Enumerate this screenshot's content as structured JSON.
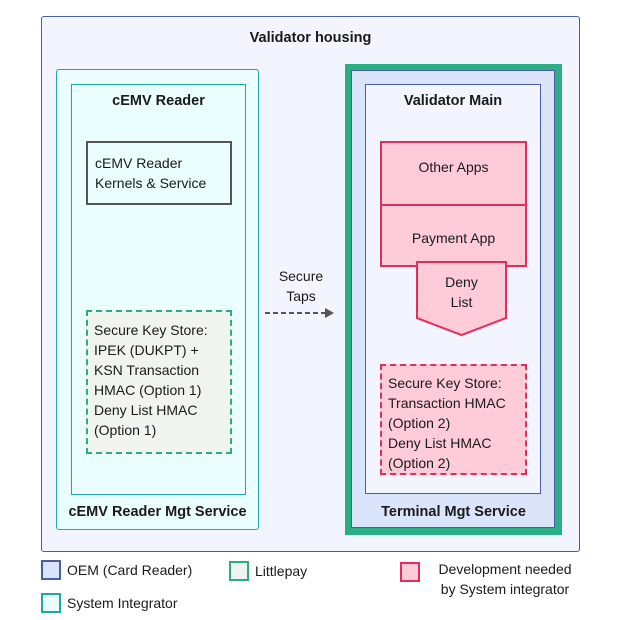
{
  "housing": {
    "title": "Validator housing"
  },
  "cemv_mgt": {
    "title": "cEMV Reader Mgt Service",
    "reader": {
      "title": "cEMV Reader",
      "kernels_lines": [
        "cEMV Reader",
        "Kernels & Service"
      ],
      "keystore_lines": [
        "Secure Key Store:",
        "IPEK (DUKPT) +",
        "KSN Transaction",
        "HMAC (Option 1)",
        "Deny List HMAC",
        "(Option 1)"
      ]
    }
  },
  "connector": {
    "label_lines": [
      "Secure",
      "Taps"
    ],
    "style": "dashed-arrow"
  },
  "terminal_mgt": {
    "title": "Terminal Mgt Service",
    "validator_main": {
      "title": "Validator Main",
      "other_apps": "Other Apps",
      "payment_app": "Payment App",
      "deny_list_lines": [
        "Deny",
        "List"
      ],
      "keystore_lines": [
        "Secure Key Store:",
        "Transaction HMAC",
        "(Option 2)",
        "Deny List HMAC",
        "(Option 2)"
      ]
    }
  },
  "legend": [
    {
      "label": "OEM (Card Reader)",
      "fill": "#dae4fb",
      "stroke": "#4a5ea8"
    },
    {
      "label": "Littlepay",
      "fill": "#eff5ee",
      "stroke": "#2eaa84"
    },
    {
      "label": "System Integrator",
      "fill": "#eafefd",
      "stroke": "#20a8a4"
    },
    {
      "label_lines": [
        "Development needed",
        "by System integrator"
      ],
      "fill": "#fecbd8",
      "stroke": "#e52c5b"
    }
  ]
}
